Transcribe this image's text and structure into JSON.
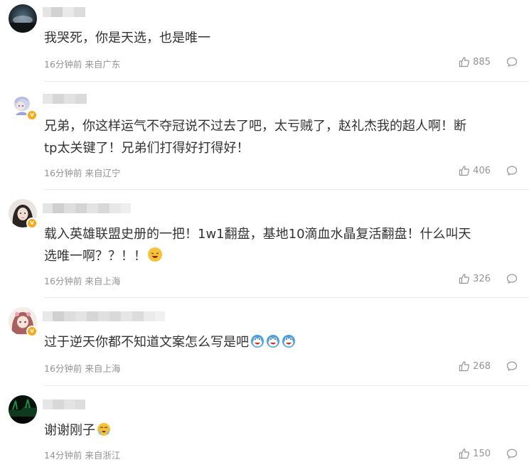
{
  "comments": [
    {
      "text": "我哭死，你是天选，也是唯一",
      "time": "16分钟前",
      "location": "来自广东",
      "likes": "885",
      "verified": false
    },
    {
      "text_line1": "兄弟，你这样运气不夺冠说不过去了吧，太亏贼了，赵礼杰我的超人啊！断",
      "text_line2": "tp太关键了！兄弟们打得好打得好！",
      "time": "16分钟前",
      "location": "来自辽宁",
      "likes": "406",
      "verified": true
    },
    {
      "text_line1": "载入英雄联盟史册的一把！1w1翻盘，基地10滴血水晶复活翻盘！什么叫天",
      "text_line2": "选唯一啊？？！！",
      "time": "16分钟前",
      "location": "来自上海",
      "likes": "326",
      "verified": true
    },
    {
      "text": "过于逆天你都不知道文案怎么写是吧",
      "time": "16分钟前",
      "location": "来自上海",
      "likes": "268",
      "verified": true
    },
    {
      "text": "谢谢刚子",
      "time": "14分钟前",
      "location": "来自浙江",
      "likes": "150",
      "verified": false
    }
  ],
  "colors": {
    "text": "#333333",
    "meta": "#939393",
    "divider": "#ececec",
    "verified_badge": "#f7a81b"
  },
  "icons": {
    "like": "thumbs-up-icon",
    "reply": "comment-bubble-icon",
    "verified": "verified-v-icon"
  }
}
